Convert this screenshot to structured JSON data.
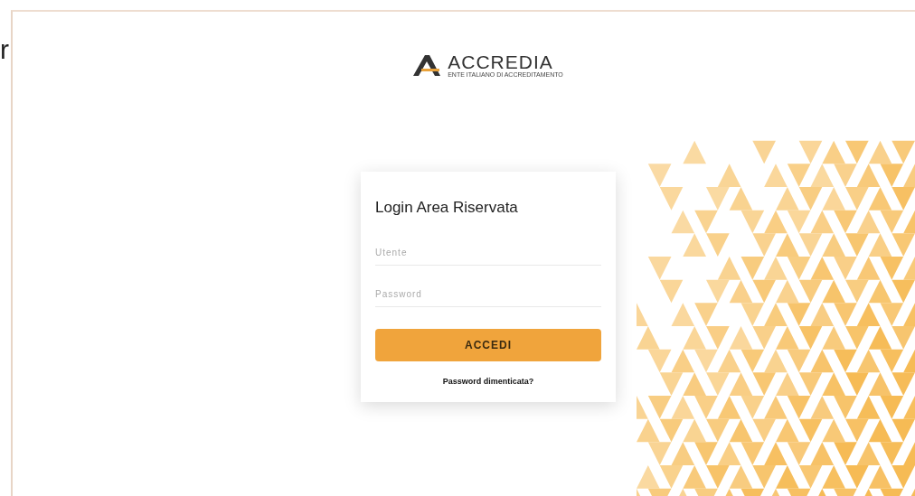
{
  "edge_text": "r",
  "logo": {
    "name": "ACCREDIA",
    "tagline": "ENTE ITALIANO DI ACCREDITAMENTO"
  },
  "login": {
    "title": "Login Area Riservata",
    "fields": [
      {
        "placeholder": "Utente"
      },
      {
        "placeholder": "Password"
      }
    ],
    "button": "ACCEDI",
    "link": "Password dimenticata?"
  }
}
